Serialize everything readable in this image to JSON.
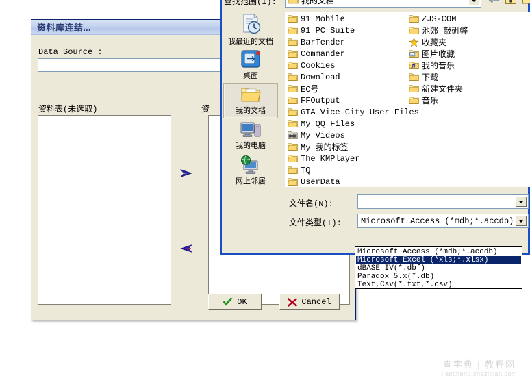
{
  "db_dialog": {
    "title": "资料库连结...",
    "data_source_label": "Data Source :",
    "data_source_value": "",
    "left_list_label": "资料表(未选取)",
    "right_list_label": "资",
    "move_right_icon": "arrow-right-icon",
    "move_left_icon": "arrow-left-icon",
    "ok_label": "OK",
    "cancel_label": "Cancel"
  },
  "file_dialog": {
    "look_in_label": "查找范围(I):",
    "look_in_value": "我的文档",
    "toolbar": [
      {
        "name": "back-button",
        "glyph": "back"
      },
      {
        "name": "up-one-level-button",
        "glyph": "up"
      },
      {
        "name": "new-folder-button",
        "glyph": "newfolder"
      },
      {
        "name": "views-button",
        "glyph": "views"
      }
    ],
    "places": [
      {
        "label": "我最近的文档",
        "icon": "recent-documents-icon",
        "selected": false
      },
      {
        "label": "桌面",
        "icon": "desktop-icon",
        "selected": false
      },
      {
        "label": "我的文档",
        "icon": "my-documents-icon",
        "selected": true
      },
      {
        "label": "我的电脑",
        "icon": "my-computer-icon",
        "selected": false
      },
      {
        "label": "网上邻居",
        "icon": "network-places-icon",
        "selected": false
      }
    ],
    "files_col1": [
      {
        "name": "91 Mobile",
        "icon": "folder-icon"
      },
      {
        "name": "91 PC Suite",
        "icon": "folder-icon"
      },
      {
        "name": "BarTender",
        "icon": "folder-icon"
      },
      {
        "name": "Commander",
        "icon": "folder-icon"
      },
      {
        "name": "Cookies",
        "icon": "folder-icon"
      },
      {
        "name": "Download",
        "icon": "folder-icon"
      },
      {
        "name": "EC号",
        "icon": "folder-icon"
      },
      {
        "name": "FFOutput",
        "icon": "folder-icon"
      },
      {
        "name": "GTA Vice City User Files",
        "icon": "folder-icon"
      },
      {
        "name": "My QQ Files",
        "icon": "folder-icon"
      },
      {
        "name": "My Videos",
        "icon": "video-folder-icon"
      },
      {
        "name": "My 我的标签",
        "icon": "folder-icon"
      },
      {
        "name": "The KMPlayer",
        "icon": "folder-icon"
      },
      {
        "name": "TQ",
        "icon": "folder-icon"
      },
      {
        "name": "UserData",
        "icon": "folder-icon"
      }
    ],
    "files_col2": [
      {
        "name": "ZJS-COM",
        "icon": "folder-icon"
      },
      {
        "name": "池郊 敲矾弊",
        "icon": "folder-icon"
      },
      {
        "name": "收藏夹",
        "icon": "favorites-star-icon"
      },
      {
        "name": "图片收藏",
        "icon": "pictures-folder-icon"
      },
      {
        "name": "我的音乐",
        "icon": "music-folder-icon"
      },
      {
        "name": "下载",
        "icon": "folder-icon"
      },
      {
        "name": "新建文件夹",
        "icon": "folder-icon"
      },
      {
        "name": "音乐",
        "icon": "folder-icon"
      }
    ],
    "file_name_label": "文件名(N):",
    "file_name_value": "",
    "file_type_label": "文件类型(T):",
    "file_type_value": "Microsoft Access (*mdb;*.accdb)",
    "file_type_options": [
      {
        "label": "Microsoft Access (*mdb;*.accdb)",
        "selected": false
      },
      {
        "label": "Microsoft Excel (*xls;*.xlsx)",
        "selected": true
      },
      {
        "label": "dBASE IV(*.dbf)",
        "selected": false
      },
      {
        "label": "Paradox 5.x(*.db)",
        "selected": false
      },
      {
        "label": "Text,Csv(*.txt,*.csv)",
        "selected": false
      }
    ]
  },
  "watermark": {
    "main": "查字典 | 教程网",
    "sub": "jiaocheng.chazidian.com"
  },
  "colors": {
    "dialog_face": "#ece9d8",
    "dialog_border": "#1a4fc4",
    "selection": "#0a246a",
    "folder": "#fce38a"
  }
}
